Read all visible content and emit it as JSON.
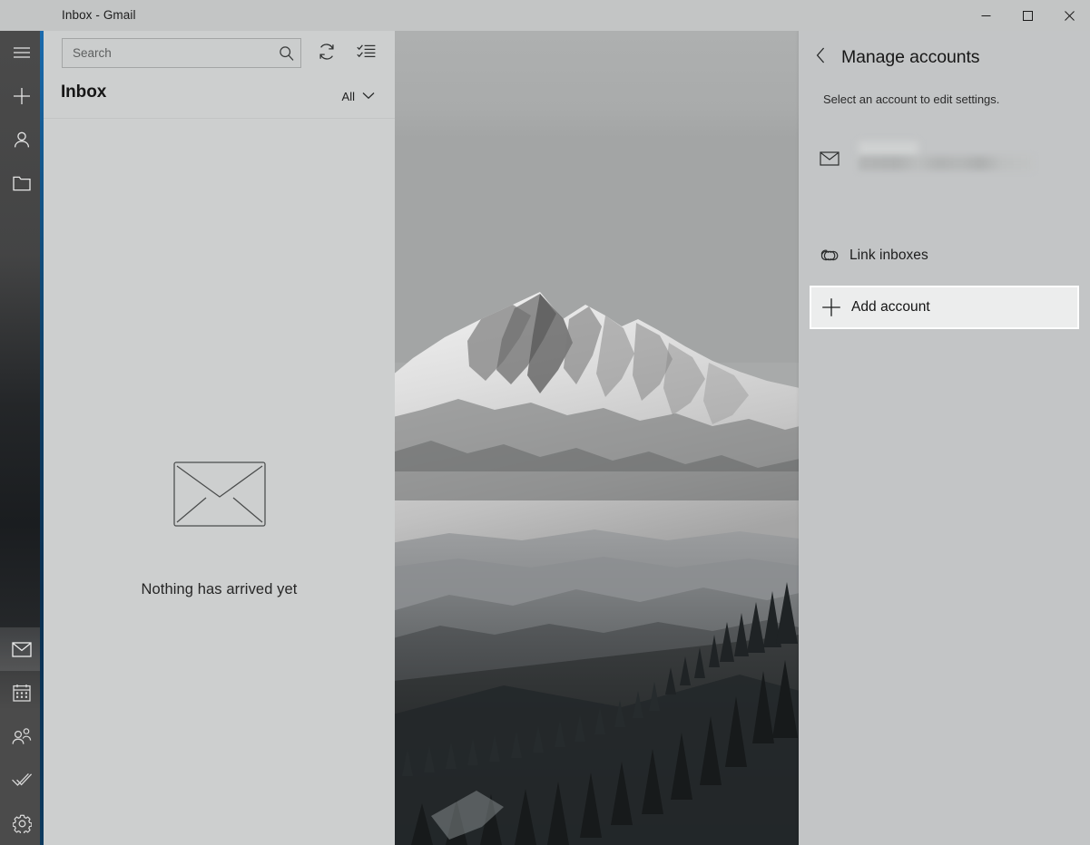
{
  "window": {
    "title": "Inbox - Gmail",
    "controls": {
      "minimize": "Minimize",
      "maximize": "Maximize",
      "close": "Close"
    },
    "accent_color": "#14598f"
  },
  "rail": {
    "top_items": [
      {
        "name": "menu-icon",
        "label": "Menu"
      },
      {
        "name": "new-mail-icon",
        "label": "New mail"
      },
      {
        "name": "accounts-icon",
        "label": "Accounts"
      },
      {
        "name": "folders-icon",
        "label": "Folders"
      }
    ],
    "bottom_items": [
      {
        "name": "mail-icon",
        "label": "Mail",
        "selected": true
      },
      {
        "name": "calendar-icon",
        "label": "Calendar",
        "selected": false
      },
      {
        "name": "people-icon",
        "label": "People",
        "selected": false
      },
      {
        "name": "todo-icon",
        "label": "To Do",
        "selected": false
      },
      {
        "name": "settings-gear-icon",
        "label": "Settings",
        "selected": false
      }
    ]
  },
  "message_list": {
    "search": {
      "placeholder": "Search",
      "icon": "search-icon"
    },
    "toolbar": {
      "sync_icon": "sync-icon",
      "sync_label": "Sync this view",
      "selection_icon": "selection-mode-icon",
      "selection_label": "Enter selection mode"
    },
    "folder_title": "Inbox",
    "filter": {
      "label": "All",
      "icon": "chevron-down-icon"
    },
    "empty_state": {
      "icon": "envelope-icon",
      "text": "Nothing has arrived yet"
    }
  },
  "reading_pane": {
    "background_image": "grayscale-mountain-photo"
  },
  "flyout": {
    "back_icon": "chevron-left-icon",
    "title": "Manage accounts",
    "subtitle": "Select an account to edit settings.",
    "account": {
      "icon": "envelope-icon",
      "name": "",
      "address": "",
      "redacted": true
    },
    "items": [
      {
        "name": "link-inboxes",
        "label": "Link inboxes",
        "icon": "link-icon",
        "highlighted": false
      },
      {
        "name": "add-account",
        "label": "Add account",
        "icon": "plus-icon",
        "highlighted": true
      }
    ]
  }
}
